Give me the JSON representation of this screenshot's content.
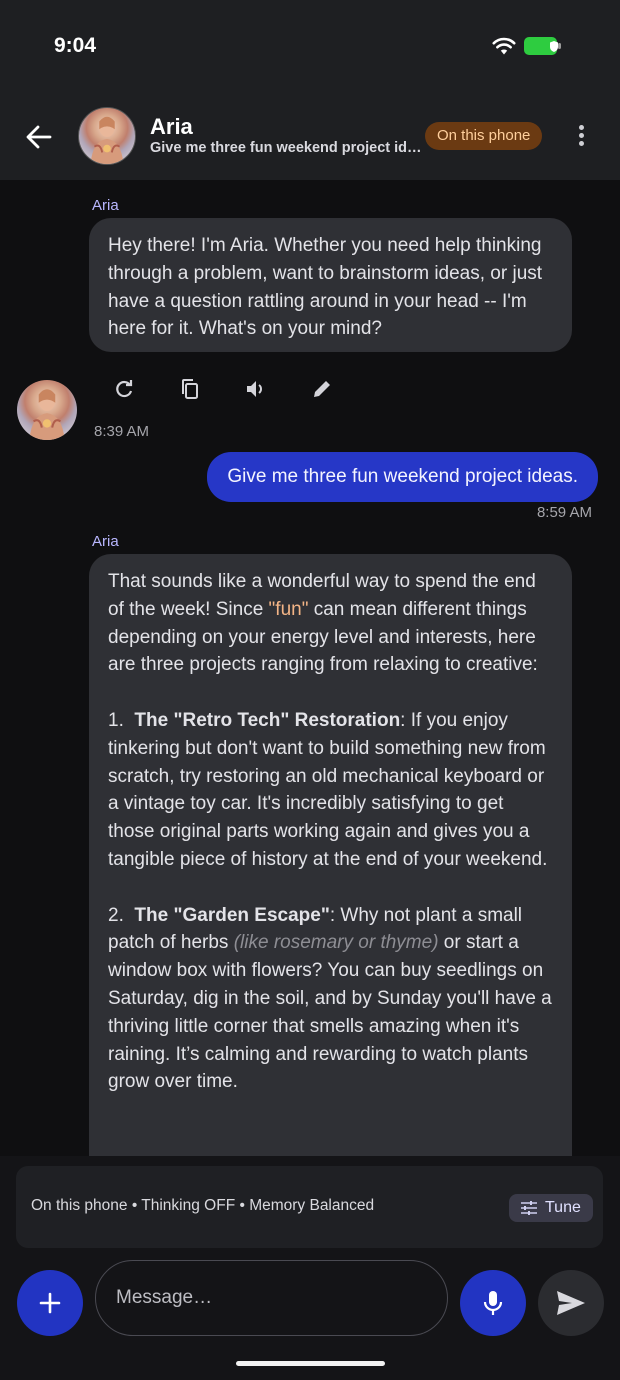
{
  "status_bar": {
    "time": "9:04",
    "wifi_icon": "wifi-icon",
    "battery_icon": "battery-icon",
    "battery_color": "#2ecc40"
  },
  "header": {
    "name": "Aria",
    "subtitle": "Give me three fun weekend project ideas.",
    "badge": "On this phone",
    "badge_color": "#6b3a12",
    "back_icon": "arrow-left-icon",
    "more_icon": "more-vertical-icon"
  },
  "messages": [
    {
      "role": "assistant",
      "sender": "Aria",
      "text": "Hey there! I'm Aria. Whether you need help thinking through a problem, want to brainstorm ideas, or just have a question rattling around in your head -- I'm here for it. What's on your mind?",
      "time": "8:39 AM",
      "actions": [
        "refresh-icon",
        "copy-icon",
        "speaker-icon",
        "edit-icon"
      ]
    },
    {
      "role": "user",
      "text": "Give me three fun weekend project ideas.",
      "time": "8:59 AM"
    },
    {
      "role": "assistant",
      "sender": "Aria",
      "intro_before": "That sounds like a wonderful way to spend the end of the week! Since ",
      "intro_highlight": "\"fun\"",
      "intro_after": " can mean different things depending on your energy level and interests, here are three projects ranging from relaxing to creative:",
      "item1_num": "1.",
      "item1_title": "The \"Retro Tech\" Restoration",
      "item1_body": ": If you enjoy tinkering but don't want to build something new from scratch, try restoring an old mechanical keyboard or a vintage toy car. It's incredibly satisfying to get those original parts working again and gives you a tangible piece of history at the end of your weekend.",
      "item2_num": "2.",
      "item2_title": "The \"Garden Escape\"",
      "item2_body_a": ": Why not plant a small patch of herbs ",
      "item2_aside": "(like rosemary or thyme)",
      "item2_body_b": " or start a window box with flowers? You can buy seedlings on Saturday, dig in the soil, and by Sunday you'll have a thriving little corner that smells amazing when it's raining. It’s calming and rewarding to watch plants grow over time."
    }
  ],
  "settings_bar": {
    "text": "On this phone • Thinking OFF • Memory Balanced",
    "tune_label": "Tune",
    "tune_icon": "sliders-icon"
  },
  "composer": {
    "placeholder": "Message…",
    "add_icon": "plus-icon",
    "mic_icon": "microphone-icon",
    "send_icon": "send-icon",
    "accent": "#2234c2"
  }
}
